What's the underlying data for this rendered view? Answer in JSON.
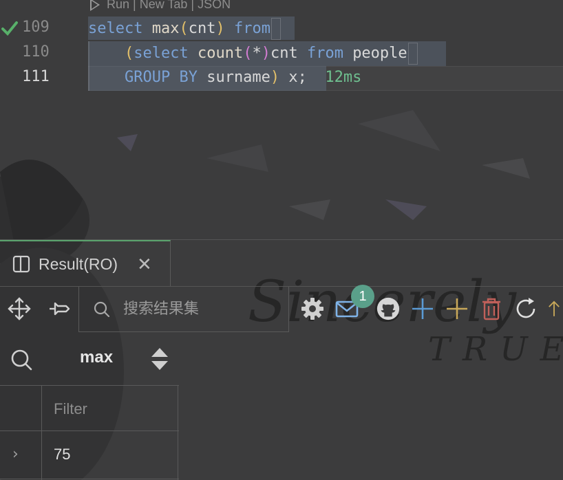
{
  "editor": {
    "codelens": "Run | New Tab | JSON",
    "lines": [
      {
        "number": "109",
        "status": "success"
      },
      {
        "number": "110"
      },
      {
        "number": "111"
      }
    ],
    "code": {
      "l1": {
        "kw1": "select",
        "fn": "max",
        "open": "(",
        "arg": "cnt",
        "close": ")",
        "kw2": "from"
      },
      "l2": {
        "open": "(",
        "kw1": "select",
        "fn": "count",
        "p_open": "(",
        "star": "*",
        "p_close": ")",
        "alias": "cnt",
        "kw2": "from",
        "table": "people"
      },
      "l3": {
        "kw": "GROUP BY",
        "col": "surname",
        "close": ")",
        "tail": "x;",
        "duration": "12ms"
      }
    }
  },
  "result": {
    "tab_label": "Result(RO)",
    "search_placeholder": "搜索结果集",
    "notification_count": "1",
    "column": "max",
    "filter_placeholder": "Filter",
    "rows": [
      {
        "max": "75"
      }
    ]
  },
  "background": {
    "word1": "Sincerely",
    "word2": "TRUE"
  },
  "colors": {
    "accent_green": "#5aa36d",
    "keyword": "#7aa2d6",
    "paren": "#e3c06a",
    "duration": "#6fbf8f"
  }
}
